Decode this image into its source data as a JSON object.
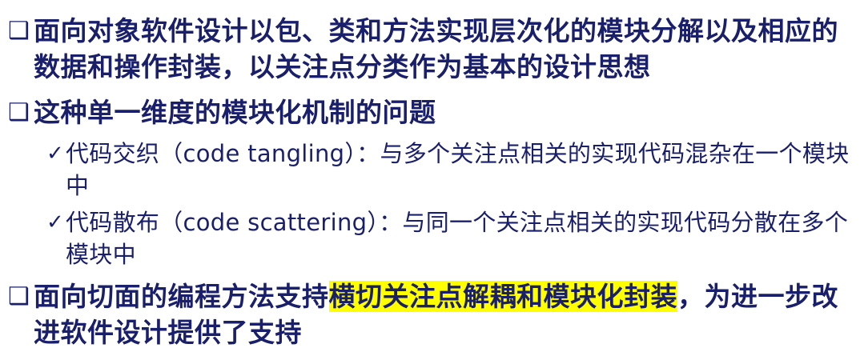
{
  "bullets": [
    {
      "marker": "❑",
      "text": "面向对象软件设计以包、类和方法实现层次化的模块分解以及相应的数据和操作封装，以关注点分类作为基本的设计思想"
    },
    {
      "marker": "❑",
      "text": "这种单一维度的模块化机制的问题"
    },
    {
      "marker": "❑",
      "text_before": "面向切面的编程方法支持",
      "text_highlight": "横切关注点解耦和模块化封装",
      "text_after": "，为进一步改进软件设计提供了支持"
    }
  ],
  "sub_bullets": [
    {
      "marker": "✓",
      "text": "代码交织（code tangling）：与多个关注点相关的实现代码混杂在一个模块中"
    },
    {
      "marker": "✓",
      "text": "代码散布（code scattering）：与同一个关注点相关的实现代码分散在多个模块中"
    }
  ],
  "colors": {
    "text": "#1a1f6b",
    "highlight": "#ffff00"
  }
}
